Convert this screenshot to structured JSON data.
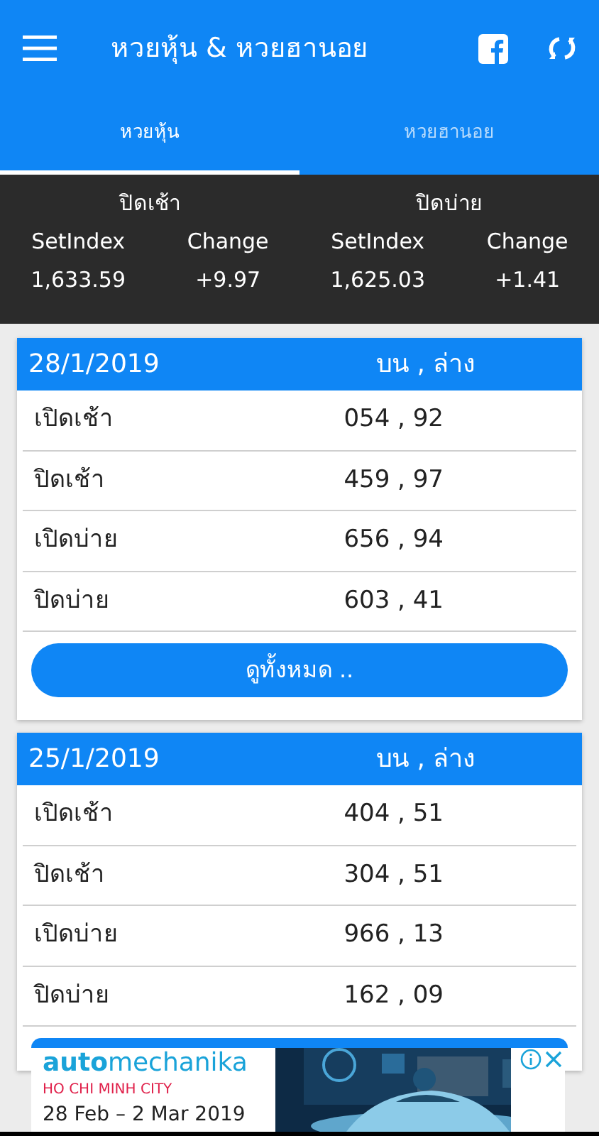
{
  "app_bar": {
    "title": "หวยหุ้น & หวยฮานอย"
  },
  "tabs": [
    {
      "label": "หวยหุ้น",
      "selected": true
    },
    {
      "label": "หวยฮานอย",
      "selected": false
    }
  ],
  "index_summary": [
    {
      "session": "ปิดเช้า",
      "columns": [
        {
          "heading": "SetIndex",
          "value": "1,633.59"
        },
        {
          "heading": "Change",
          "value": "+9.97"
        }
      ]
    },
    {
      "session": "ปิดบ่าย",
      "columns": [
        {
          "heading": "SetIndex",
          "value": "1,625.03"
        },
        {
          "heading": "Change",
          "value": "+1.41"
        }
      ]
    }
  ],
  "results": [
    {
      "date": "28/1/2019",
      "column_heading": "บน , ล่าง",
      "rows": [
        {
          "label": "เปิดเช้า",
          "numbers": "054 , 92"
        },
        {
          "label": "ปิดเช้า",
          "numbers": "459 , 97"
        },
        {
          "label": "เปิดบ่าย",
          "numbers": "656 , 94"
        },
        {
          "label": "ปิดบ่าย",
          "numbers": "603 , 41"
        }
      ],
      "more_button": "ดูทั้งหมด .."
    },
    {
      "date": "25/1/2019",
      "column_heading": "บน , ล่าง",
      "rows": [
        {
          "label": "เปิดเช้า",
          "numbers": "404 , 51"
        },
        {
          "label": "ปิดเช้า",
          "numbers": "304 , 51"
        },
        {
          "label": "เปิดบ่าย",
          "numbers": "966 , 13"
        },
        {
          "label": "ปิดบ่าย",
          "numbers": "162 , 09"
        }
      ]
    }
  ],
  "ad": {
    "brand": "**auto**mechanika",
    "city": "HO CHI MINH CITY",
    "dates": "28 Feb – 2 Mar 2019"
  }
}
